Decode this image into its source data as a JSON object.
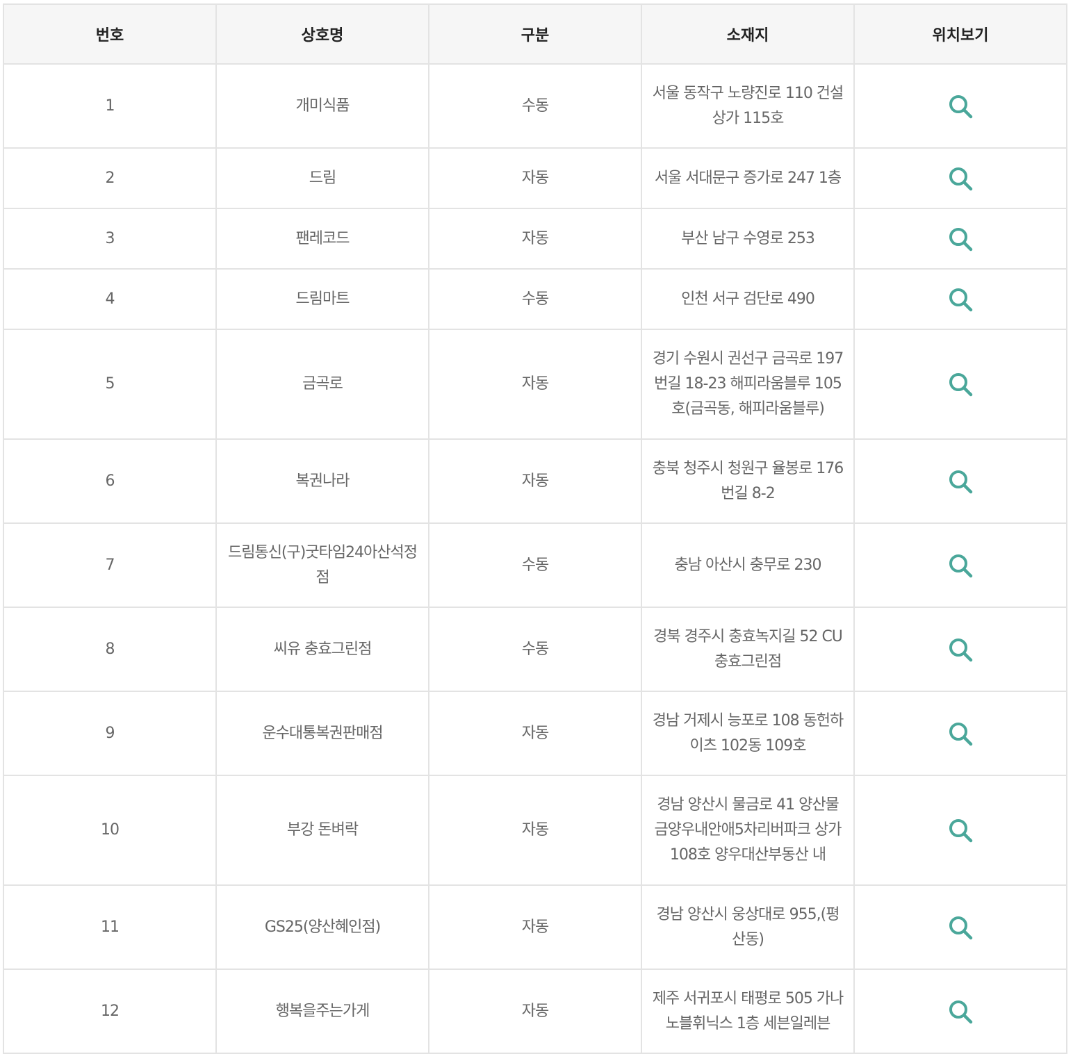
{
  "table": {
    "headers": {
      "num": "번호",
      "name": "상호명",
      "type": "구분",
      "address": "소재지",
      "map": "위치보기"
    },
    "accent_color": "#4aa79a",
    "map_icon": "search-icon",
    "rows": [
      {
        "num": "1",
        "name": "개미식품",
        "type": "수동",
        "address": "서울 동작구 노량진로 110 건설상가 115호",
        "h": 121
      },
      {
        "num": "2",
        "name": "드림",
        "type": "자동",
        "address": "서울 서대문구 증가로 247 1층",
        "h": 87
      },
      {
        "num": "3",
        "name": "팬레코드",
        "type": "자동",
        "address": "부산 남구 수영로 253",
        "h": 87
      },
      {
        "num": "4",
        "name": "드림마트",
        "type": "수동",
        "address": "인천 서구 검단로 490",
        "h": 87
      },
      {
        "num": "5",
        "name": "금곡로",
        "type": "자동",
        "address": "경기 수원시 권선구 금곡로 197번길 18-23 해피라움블루 105호(금곡동, 해피라움블루)",
        "h": 158
      },
      {
        "num": "6",
        "name": "복권나라",
        "type": "자동",
        "address": "충북 청주시 청원구 율봉로 176번길 8-2",
        "h": 121
      },
      {
        "num": "7",
        "name": "드림통신(구)굿타임24아산석정점",
        "type": "수동",
        "address": "충남 아산시 충무로 230",
        "h": 121
      },
      {
        "num": "8",
        "name": "씨유 충효그린점",
        "type": "수동",
        "address": "경북 경주시 충효녹지길 52 CU충효그린점",
        "h": 121
      },
      {
        "num": "9",
        "name": "운수대통복권판매점",
        "type": "자동",
        "address": "경남 거제시 능포로 108 동헌하이츠 102동 109호",
        "h": 121
      },
      {
        "num": "10",
        "name": "부강 돈벼락",
        "type": "자동",
        "address": "경남 양산시 물금로 41 양산물금양우내안애5차리버파크 상가108호 양우대산부동산 내",
        "h": 158
      },
      {
        "num": "11",
        "name": "GS25(양산혜인점)",
        "type": "자동",
        "address": "경남 양산시 웅상대로 955,(평산동)",
        "h": 121
      },
      {
        "num": "12",
        "name": "행복을주는가게",
        "type": "자동",
        "address": "제주 서귀포시 태평로 505 가나노블휘닉스 1층 세븐일레븐",
        "h": 121
      }
    ]
  }
}
